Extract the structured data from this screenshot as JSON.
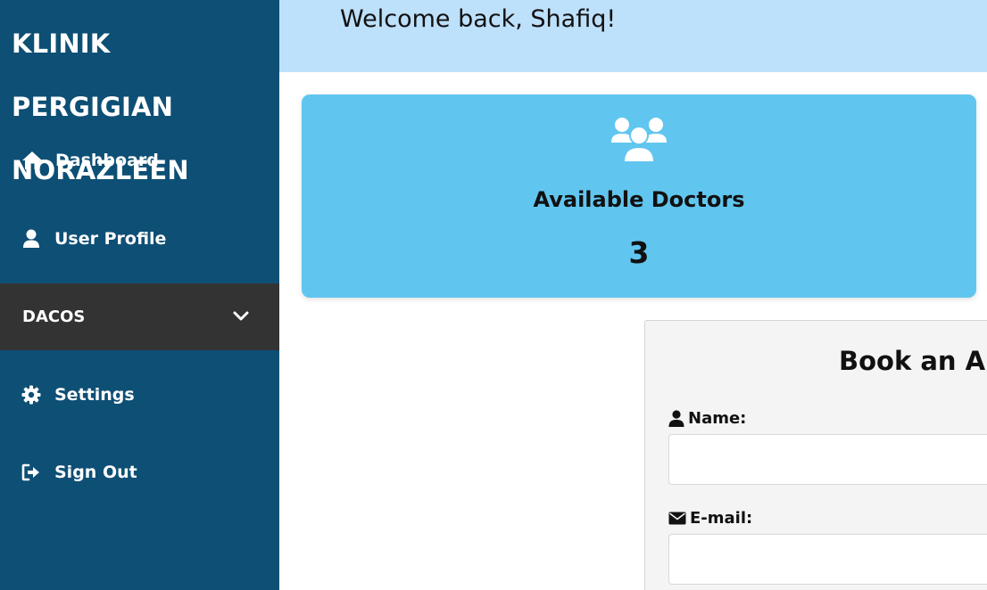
{
  "sidebar": {
    "brand": "KLINIK PERGIGIAN NORAZLEEN",
    "items": [
      {
        "label": "Dashboard",
        "icon": "home-icon"
      },
      {
        "label": "User Profile",
        "icon": "user-icon"
      },
      {
        "label": "DACOS",
        "icon": "chevron-down-icon"
      },
      {
        "label": "Settings",
        "icon": "gear-icon"
      },
      {
        "label": "Sign Out",
        "icon": "sign-out-icon"
      }
    ]
  },
  "header": {
    "welcome": "Welcome back, Shafiq!"
  },
  "stats": {
    "title": "Available Doctors",
    "value": "3",
    "icon": "users-icon"
  },
  "booking": {
    "title": "Book an Ap",
    "name_label": "Name:",
    "email_label": "E-mail:",
    "name_value": "",
    "email_value": ""
  },
  "colors": {
    "sidebar": "#0e4f75",
    "sidebar_active": "#333333",
    "topbar": "#bde0fb",
    "card": "#61c6ef",
    "form_bg": "#f4f4f4"
  }
}
